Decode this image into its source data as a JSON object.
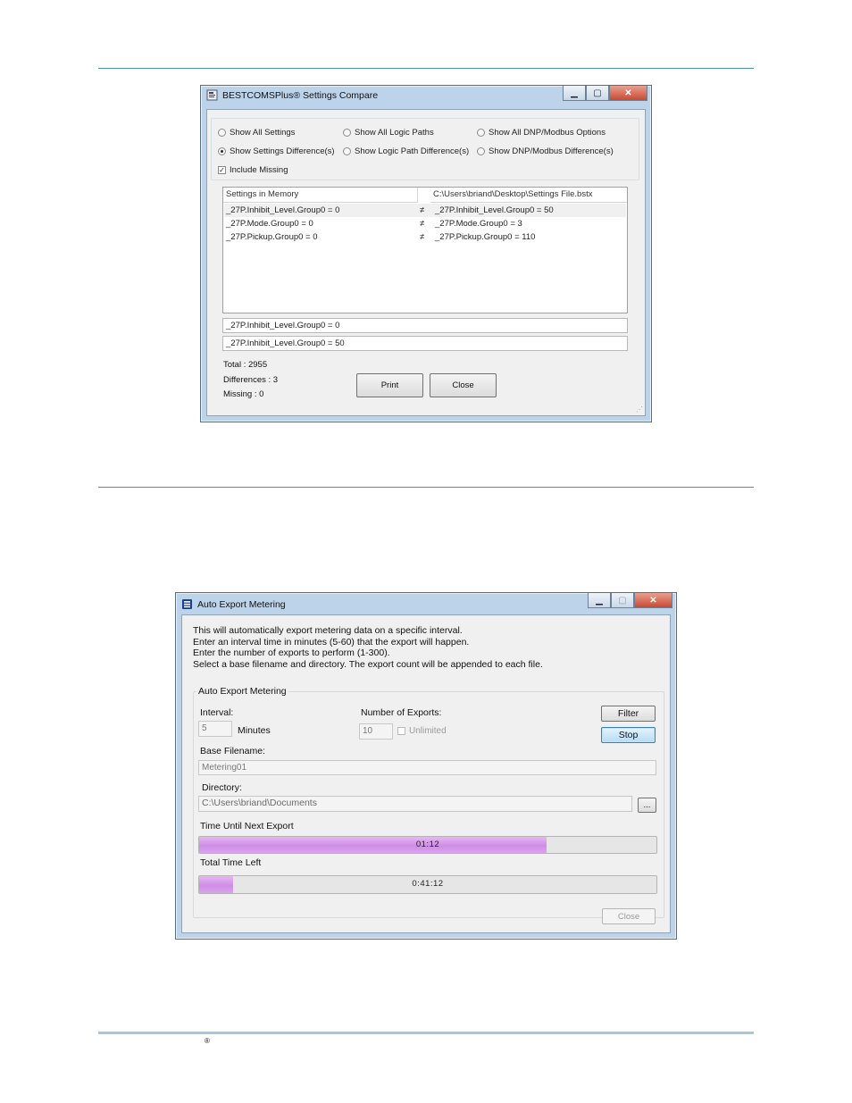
{
  "compare_window": {
    "title": "BESTCOMSPlus® Settings Compare",
    "options": [
      {
        "label": "Show All Settings",
        "selected": false
      },
      {
        "label": "Show All Logic Paths",
        "selected": false
      },
      {
        "label": "Show All DNP/Modbus Options",
        "selected": false
      },
      {
        "label": "Show Settings Difference(s)",
        "selected": true
      },
      {
        "label": "Show Logic Path Difference(s)",
        "selected": false
      },
      {
        "label": "Show DNP/Modbus Difference(s)",
        "selected": false
      }
    ],
    "include_missing": {
      "label": "Include Missing",
      "checked": true
    },
    "columns": {
      "left": "Settings in Memory",
      "right": "C:\\Users\\briand\\Desktop\\Settings File.bstx"
    },
    "rows": [
      {
        "left": "_27P.Inhibit_Level.Group0 = 0",
        "sign": "≠",
        "right": "_27P.Inhibit_Level.Group0 = 50"
      },
      {
        "left": "_27P.Mode.Group0 = 0",
        "sign": "≠",
        "right": "_27P.Mode.Group0 = 3"
      },
      {
        "left": "_27P.Pickup.Group0 = 0",
        "sign": "≠",
        "right": "_27P.Pickup.Group0 = 110"
      }
    ],
    "detail_left": "_27P.Inhibit_Level.Group0 = 0",
    "detail_right": "_27P.Inhibit_Level.Group0 = 50",
    "stats": {
      "total": "Total : 2955",
      "differences": "Differences : 3",
      "missing": "Missing : 0"
    },
    "print_label": "Print",
    "close_label": "Close"
  },
  "export_window": {
    "title": "Auto Export Metering",
    "description": [
      "This will automatically export metering data on a specific interval.",
      "Enter an interval time in minutes (5-60) that the export will happen.",
      "Enter the number of exports to perform (1-300).",
      "Select a base filename and directory. The export count will be appended to each file."
    ],
    "group_label": "Auto Export Metering",
    "interval_label": "Interval:",
    "interval_value": "5",
    "minutes_label": "Minutes",
    "exports_label": "Number of Exports:",
    "exports_value": "10",
    "unlimited_label": "Unlimited",
    "filter_label": "Filter",
    "stop_label": "Stop",
    "base_filename_label": "Base Filename:",
    "base_filename_value": "Metering01",
    "directory_label": "Directory:",
    "directory_value": "C:\\Users\\briand\\Documents",
    "browse_label": "...",
    "next_export_label": "Time Until Next Export",
    "next_export_value": "01:12",
    "next_export_fraction": 0.76,
    "total_left_label": "Total Time Left",
    "total_left_value": "0:41:12",
    "total_left_fraction": 0.075,
    "close_label": "Close"
  },
  "footer": {
    "mark": "®"
  },
  "colors": {
    "rule": "#4a90b8",
    "progress": "#d59be9",
    "titlebar": "#bcd3ea"
  }
}
